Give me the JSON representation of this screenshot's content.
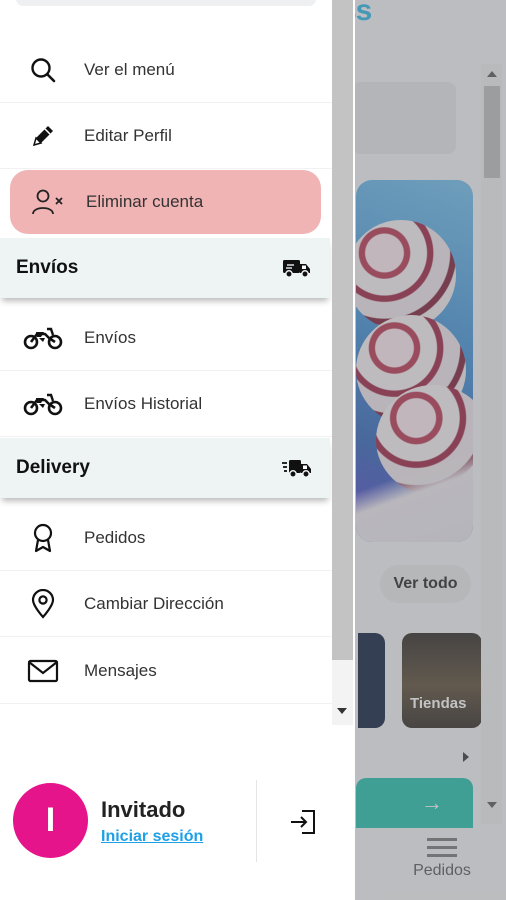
{
  "background": {
    "logo_text": "ss",
    "view_all_label": "Ver todo",
    "store_card_label": "Tiendas",
    "tab_orders_label": "Pedidos"
  },
  "menu": {
    "items": [
      {
        "label": "Ver el menú",
        "icon": "search-icon"
      },
      {
        "label": "Editar Perfil",
        "icon": "pencil-icon"
      },
      {
        "label": "Eliminar cuenta",
        "icon": "user-remove-icon"
      }
    ],
    "sections": [
      {
        "title": "Envíos",
        "icon": "delivery-truck-icon",
        "items": [
          {
            "label": "Envíos",
            "icon": "motorcycle-icon"
          },
          {
            "label": "Envíos Historial",
            "icon": "motorcycle-icon"
          }
        ]
      },
      {
        "title": "Delivery",
        "icon": "fast-truck-icon",
        "items": [
          {
            "label": "Pedidos",
            "icon": "award-ribbon-icon"
          },
          {
            "label": "Cambiar Dirección",
            "icon": "location-pin-icon"
          },
          {
            "label": "Mensajes",
            "icon": "envelope-icon"
          }
        ]
      }
    ]
  },
  "user": {
    "avatar_initial": "I",
    "name": "Invitado",
    "login_label": "Iniciar sesión",
    "logout_icon": "sign-in-icon"
  },
  "colors": {
    "accent_danger": "#f1b4b5",
    "avatar": "#e6148a",
    "link": "#1ea0e6",
    "section_bg": "#eef3f4"
  }
}
